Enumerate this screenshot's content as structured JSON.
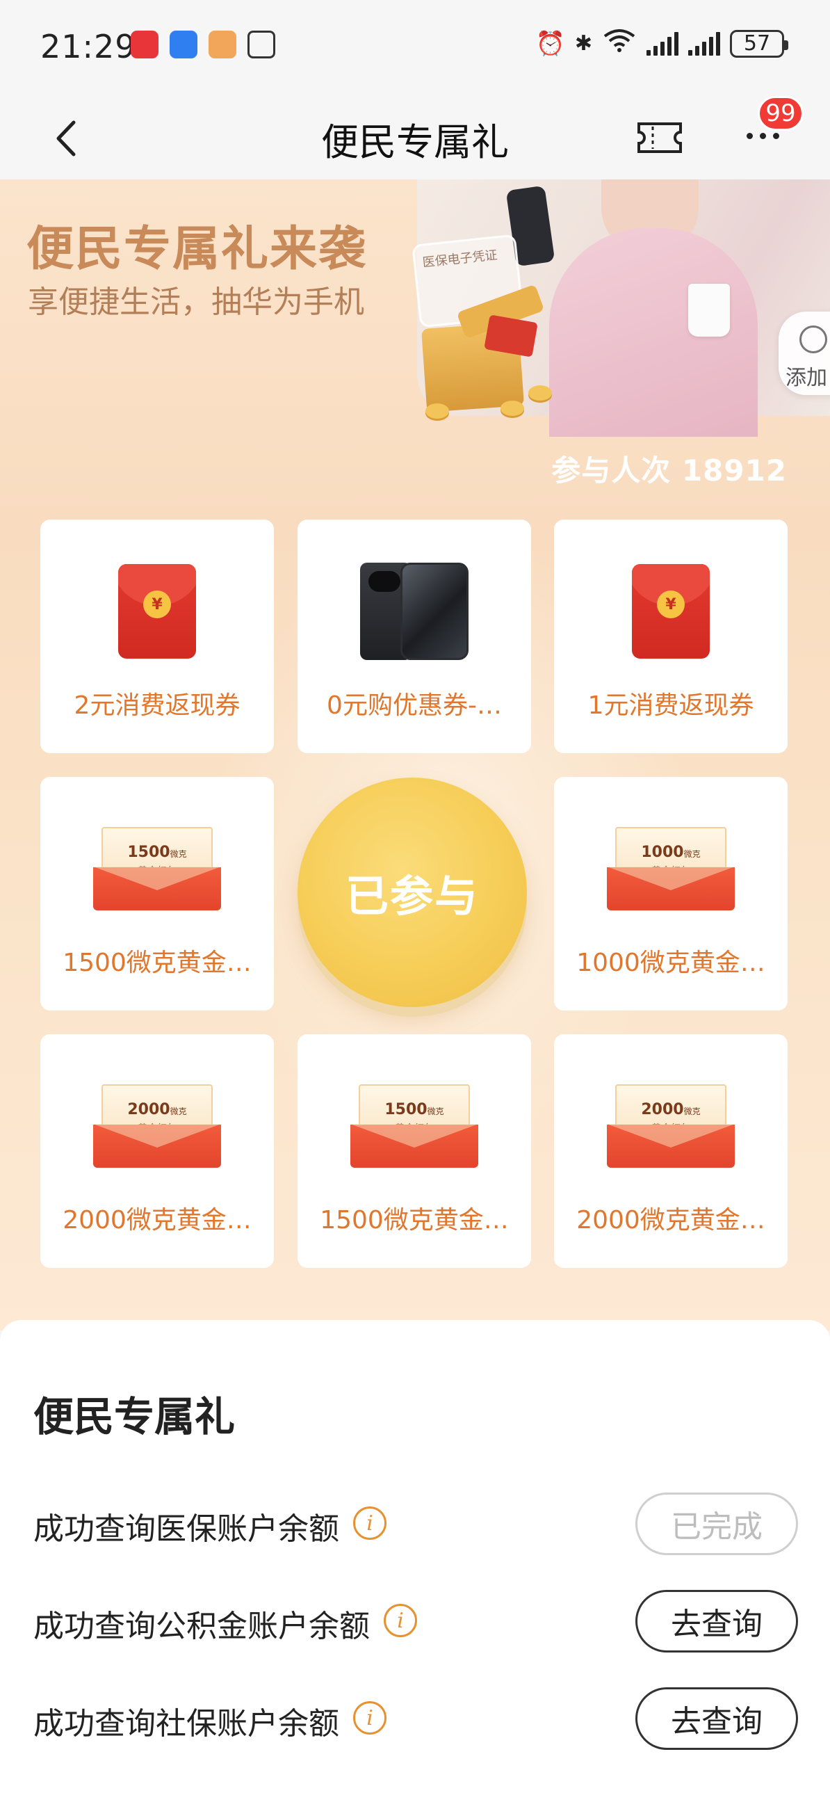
{
  "status_bar": {
    "time": "21:29",
    "battery": "57",
    "icons": [
      "alarm-icon",
      "bluetooth-icon",
      "wifi-icon",
      "signal-icon",
      "signal-icon"
    ]
  },
  "nav": {
    "title": "便民专属礼",
    "badge": "99"
  },
  "hero": {
    "title": "便民专属礼来袭",
    "subtitle": "享便捷生活，抽华为手机",
    "card_text": "医保电子凭证",
    "add_label": "添加",
    "participants": "参与人次 18912"
  },
  "prizes": [
    {
      "label": "2元消费返现券",
      "type": "red-envelope"
    },
    {
      "label": "0元购优惠券-…",
      "type": "phone"
    },
    {
      "label": "1元消费返现券",
      "type": "red-envelope"
    },
    {
      "label": "1500微克黄金…",
      "type": "gold-envelope",
      "amount": "1500",
      "unit": "微克",
      "sub": "黄金红包"
    },
    {
      "label": "1000微克黄金…",
      "type": "gold-envelope",
      "amount": "1000",
      "unit": "微克",
      "sub": "黄金红包"
    },
    {
      "label": "2000微克黄金…",
      "type": "gold-envelope",
      "amount": "2000",
      "unit": "微克",
      "sub": "黄金红包"
    },
    {
      "label": "1500微克黄金…",
      "type": "gold-envelope",
      "amount": "1500",
      "unit": "微克",
      "sub": "黄金红包"
    },
    {
      "label": "2000微克黄金…",
      "type": "gold-envelope",
      "amount": "2000",
      "unit": "微克",
      "sub": "黄金红包"
    }
  ],
  "draw_button": "已参与",
  "tasks": {
    "title": "便民专属礼",
    "items": [
      {
        "label": "成功查询医保账户余额",
        "button": "已完成",
        "done": true
      },
      {
        "label": "成功查询公积金账户余额",
        "button": "去查询",
        "done": false
      },
      {
        "label": "成功查询社保账户余额",
        "button": "去查询",
        "done": false
      }
    ]
  },
  "colors": {
    "accent_orange": "#e0772c",
    "hero_title": "#c98a5a",
    "badge_red": "#f03a36",
    "draw_gold": "#f6cd57"
  }
}
